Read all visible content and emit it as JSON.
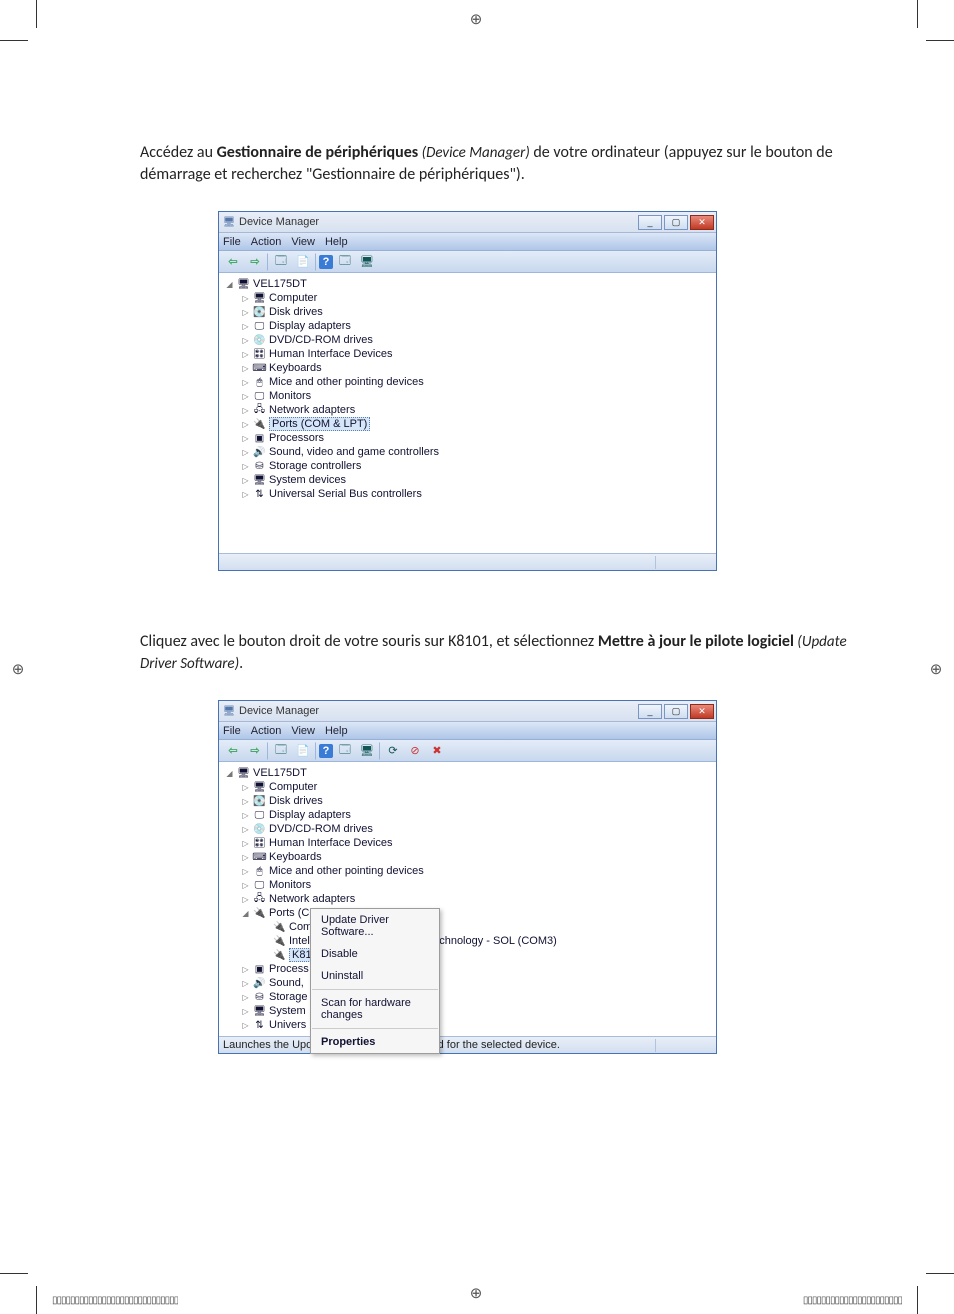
{
  "page": {
    "para1_a": "Accédez au ",
    "para1_b": "Gestionnaire de périphériques",
    "para1_c": " (Device Manager)",
    "para1_d": " de votre ordinateur (appuyez sur le bouton de démarrage et recherchez \"Gestionnaire de périphériques\").",
    "para2_a": "Cliquez avec le bouton droit de votre souris sur  K8101, et sélectionnez ",
    "para2_b": "Mettre à jour le pilote logiciel",
    "para2_c": " (Update Driver Software)",
    "para2_d": "."
  },
  "win": {
    "title": "Device Manager",
    "menu": {
      "file": "File",
      "action": "Action",
      "view": "View",
      "help": "Help"
    },
    "root": "VEL175DT",
    "nodes": {
      "computer": "Computer",
      "disk": "Disk drives",
      "display": "Display adapters",
      "dvd": "DVD/CD-ROM drives",
      "hid": "Human Interface Devices",
      "keyboards": "Keyboards",
      "mice": "Mice and other pointing devices",
      "monitors": "Monitors",
      "network": "Network adapters",
      "ports": "Ports (COM & LPT)",
      "processors": "Processors",
      "sound": "Sound, video and game controllers",
      "storage": "Storage controllers",
      "system": "System devices",
      "usb": "Universal Serial Bus controllers"
    },
    "port_children": {
      "com1": "Communications Port (COM1)",
      "sol": "Intel(R) Active Management Technology - SOL (COM3)",
      "k8101": "K8101 (COM4)"
    },
    "nodes2_partial": {
      "processors": "Process",
      "sound": "Sound,",
      "storage": "Storage",
      "system": "System",
      "usb": "Univers"
    },
    "ctx": {
      "update": "Update Driver Software...",
      "disable": "Disable",
      "uninstall": "Uninstall",
      "scan": "Scan for hardware changes",
      "properties": "Properties"
    },
    "status2": "Launches the Update Driver Software Wizard for the selected device."
  }
}
